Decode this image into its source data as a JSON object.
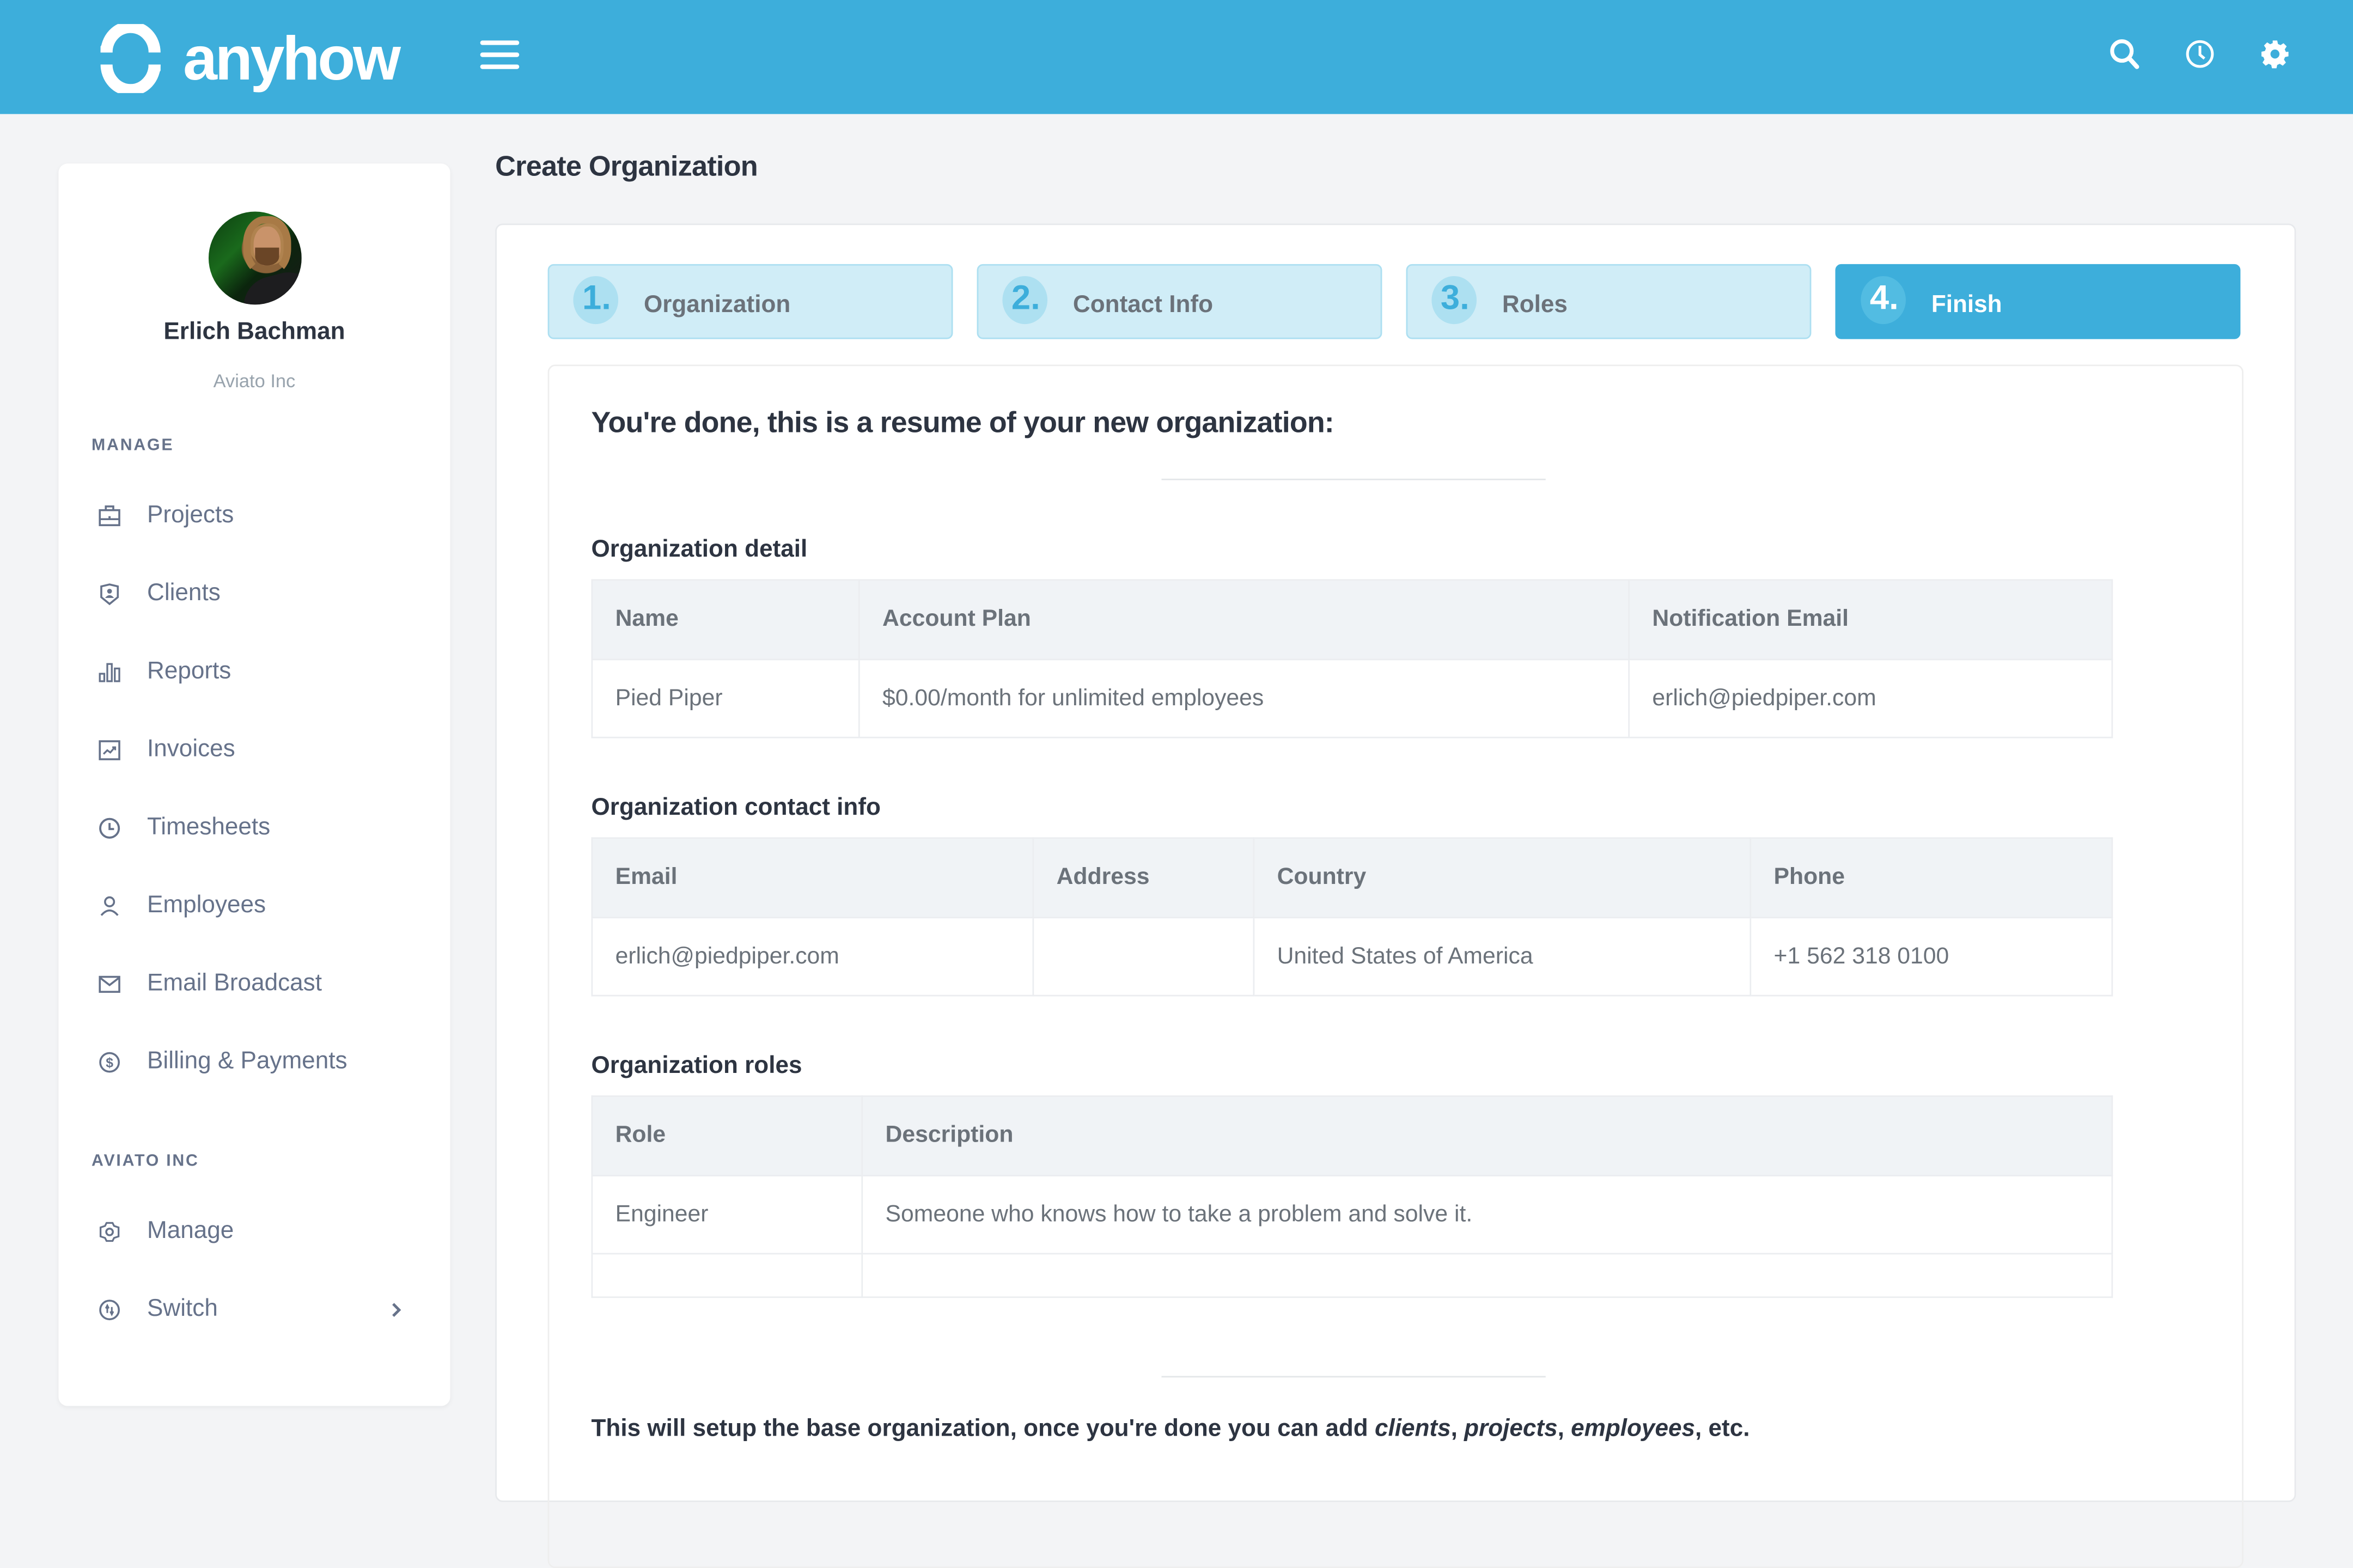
{
  "app": {
    "brand": "anyhow",
    "accent_color": "#3daedb"
  },
  "topbar": {
    "icons": [
      "search-icon",
      "clock-icon",
      "gear-icon"
    ]
  },
  "sidebar": {
    "user": {
      "name": "Erlich Bachman",
      "org": "Aviato Inc"
    },
    "sections": [
      {
        "label": "MANAGE",
        "items": [
          {
            "label": "Projects",
            "icon": "briefcase-icon"
          },
          {
            "label": "Clients",
            "icon": "shield-user-icon"
          },
          {
            "label": "Reports",
            "icon": "bar-chart-icon"
          },
          {
            "label": "Invoices",
            "icon": "trend-chart-icon"
          },
          {
            "label": "Timesheets",
            "icon": "clock-icon"
          },
          {
            "label": "Employees",
            "icon": "user-icon"
          },
          {
            "label": "Email Broadcast",
            "icon": "mail-icon"
          },
          {
            "label": "Billing & Payments",
            "icon": "dollar-circle-icon"
          }
        ]
      },
      {
        "label": "AVIATO INC",
        "items": [
          {
            "label": "Manage",
            "icon": "cog-icon"
          },
          {
            "label": "Switch",
            "icon": "switch-icon",
            "has_chevron": true
          }
        ]
      }
    ]
  },
  "main": {
    "page_title": "Create Organization",
    "steps": [
      {
        "number": "1.",
        "label": "Organization",
        "active": false
      },
      {
        "number": "2.",
        "label": "Contact Info",
        "active": false
      },
      {
        "number": "3.",
        "label": "Roles",
        "active": false
      },
      {
        "number": "4.",
        "label": "Finish",
        "active": true
      }
    ],
    "summary_heading": "You're done, this is a resume of your new organization:",
    "org_detail": {
      "title": "Organization detail",
      "columns": [
        "Name",
        "Account Plan",
        "Notification Email"
      ],
      "rows": [
        [
          "Pied Piper",
          "$0.00/month for unlimited employees",
          "erlich@piedpiper.com"
        ]
      ]
    },
    "contact_info": {
      "title": "Organization contact info",
      "columns": [
        "Email",
        "Address",
        "Country",
        "Phone"
      ],
      "rows": [
        [
          "erlich@piedpiper.com",
          "",
          "United States of America",
          "+1 562 318 0100"
        ]
      ]
    },
    "roles": {
      "title": "Organization roles",
      "columns": [
        "Role",
        "Description"
      ],
      "rows": [
        [
          "Engineer",
          "Someone who knows how to take a problem and solve it."
        ],
        [
          "",
          ""
        ]
      ]
    },
    "footnote": {
      "prefix": "This will setup the base organization, once you're done you can add ",
      "em1": "clients",
      "sep1": ", ",
      "em2": "projects",
      "sep2": ", ",
      "em3": "employees",
      "suffix": ", etc."
    }
  }
}
